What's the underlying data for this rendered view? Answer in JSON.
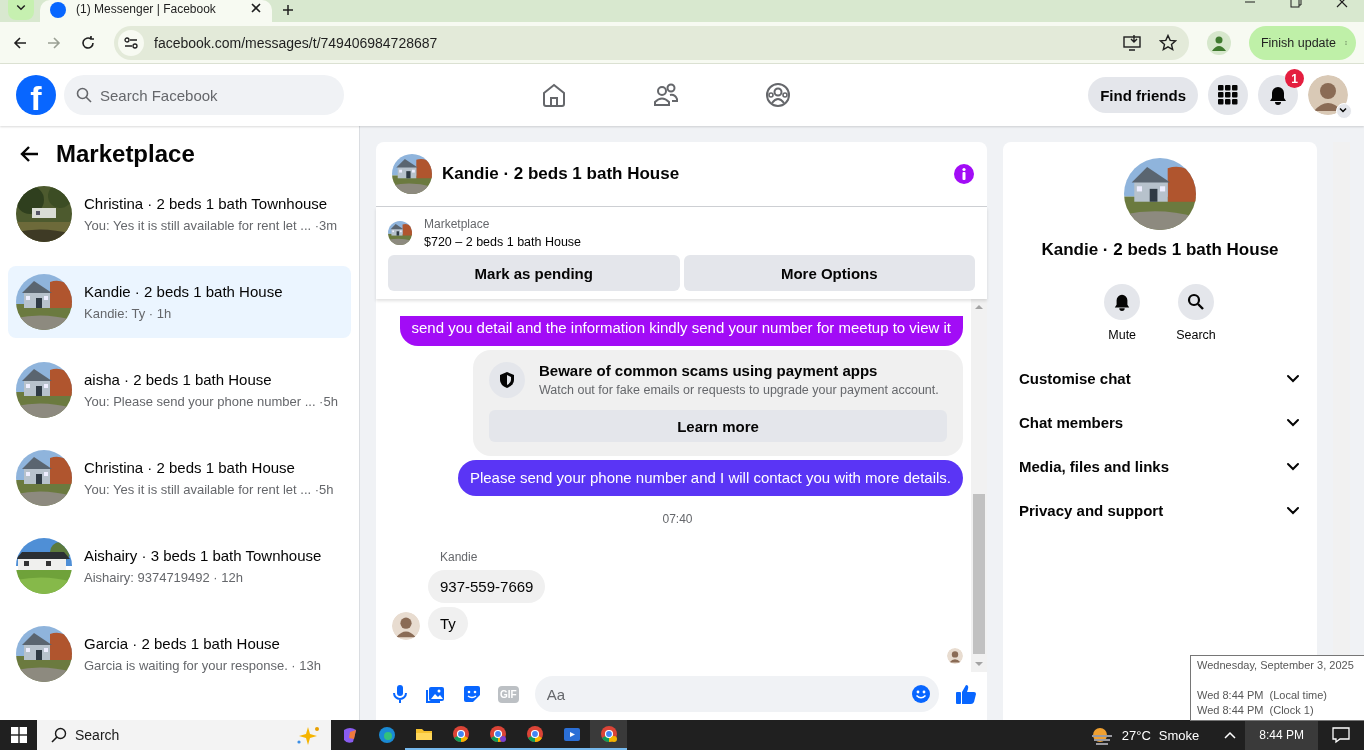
{
  "browser": {
    "tab_title": "(1) Messenger | Facebook",
    "url": "facebook.com/messages/t/749406984728687",
    "update_button": "Finish update"
  },
  "header": {
    "logo_letter": "f",
    "search_placeholder": "Search Facebook",
    "find_friends": "Find friends",
    "notification_count": "1"
  },
  "sidebar": {
    "title": "Marketplace",
    "conversations": [
      {
        "title": "Christina · 2 beds 1 bath Townhouse",
        "snippet": "You: Yes it is still available for rent let ... ·3m",
        "selected": false
      },
      {
        "title": "Kandie · 2 beds 1 bath House",
        "snippet": "Kandie: Ty · 1h",
        "selected": true
      },
      {
        "title": "aisha · 2 beds 1 bath House",
        "snippet": "You: Please send your phone number ... ·5h",
        "selected": false
      },
      {
        "title": "Christina · 2 beds 1 bath House",
        "snippet": "You: Yes it is still available for rent let ...  ·5h",
        "selected": false
      },
      {
        "title": "Aishairy · 3 beds 1 bath Townhouse",
        "snippet": "Aishairy: 9374719492 · 12h",
        "selected": false
      },
      {
        "title": "Garcia · 2 beds 1 bath House",
        "snippet": "Garcia is waiting for your response. · 13h",
        "selected": false
      }
    ]
  },
  "chat": {
    "title": "Kandie · 2 beds 1 bath House",
    "listing": {
      "label": "Marketplace",
      "item": "$720 – 2 beds 1 bath House"
    },
    "actions": [
      "Mark as pending",
      "More Options"
    ],
    "messages": [
      {
        "kind": "outgoing",
        "text": "send you detail and the information kindly send your number for meetup to view it",
        "color": "#a20cf6"
      },
      {
        "kind": "notice",
        "title": "Beware of common scams using payment apps",
        "text": "Watch out for fake emails or requests to upgrade your payment account.",
        "button": "Learn more"
      },
      {
        "kind": "outgoing",
        "text": "Please send your phone number and I will contact you with more details.",
        "color": "#5a35f5"
      },
      {
        "kind": "timestamp",
        "text": "07:40"
      },
      {
        "kind": "incoming",
        "sender": "Kandie",
        "text": "937-559-7669",
        "show_avatar": false
      },
      {
        "kind": "incoming",
        "text": "Ty",
        "show_avatar": true
      }
    ],
    "gif_label": "GIF",
    "composer_placeholder": "Aa"
  },
  "details": {
    "title": "Kandie · 2 beds 1 bath House",
    "actions": [
      {
        "kind": "mute",
        "label": "Mute"
      },
      {
        "kind": "search",
        "label": "Search"
      }
    ],
    "sections": [
      "Customise chat",
      "Chat members",
      "Media, files and links",
      "Privacy and support"
    ]
  },
  "tooltip": {
    "date": "Wednesday, September 3, 2025",
    "lines": [
      "Wed 8:44 PM  (Local time)",
      "Wed 8:44 PM  (Clock 1)"
    ]
  },
  "taskbar": {
    "search_placeholder": "Search",
    "temperature": "27°C",
    "weather": "Smoke",
    "time": "8:44 PM"
  }
}
